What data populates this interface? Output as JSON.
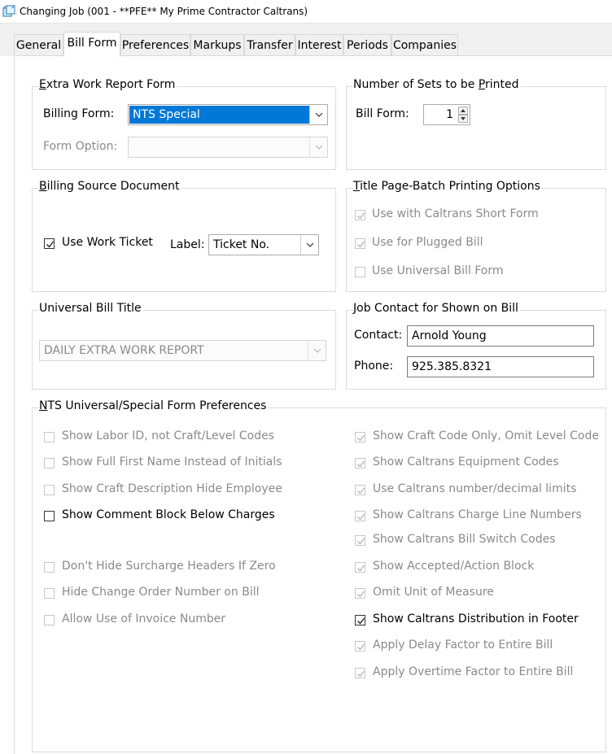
{
  "window": {
    "title": "Changing Job  (001 - **PFE** My Prime Contractor Caltrans)"
  },
  "tabs": [
    {
      "label": "General"
    },
    {
      "label": "Bill Form"
    },
    {
      "label": "Preferences"
    },
    {
      "label": "Markups"
    },
    {
      "label": "Transfer"
    },
    {
      "label": "Interest"
    },
    {
      "label": "Periods"
    },
    {
      "label": "Companies"
    }
  ],
  "extra_work_report_form": {
    "legend_underlined": "E",
    "legend_rest": "xtra Work Report Form",
    "billing_form_label": "Billing Form:",
    "billing_form_value": "NTS Special",
    "form_option_label": "Form Option:",
    "form_option_value": ""
  },
  "number_of_sets": {
    "legend": "Number of Sets to be ",
    "legend_underlined": "P",
    "legend_rest": "rinted",
    "bill_form_label": "Bill Form:",
    "bill_form_value": "1"
  },
  "billing_source_document": {
    "legend_underlined": "B",
    "legend_rest": "illing Source Document",
    "use_work_ticket_label": "Use Work Ticket",
    "use_work_ticket_checked": true,
    "label_label": "Label:",
    "label_value": "Ticket No."
  },
  "title_page_batch": {
    "legend_underlined": "T",
    "legend_rest": "itle Page-Batch Printing Options",
    "options": [
      {
        "label": "Use with Caltrans Short Form",
        "checked": true
      },
      {
        "label": "Use for Plugged Bill",
        "checked": true
      },
      {
        "label": "Use Universal Bill Form",
        "checked": false
      }
    ]
  },
  "universal_bill_title": {
    "legend": "Universal Bill Title",
    "value": "DAILY EXTRA WORK REPORT"
  },
  "job_contact": {
    "legend_underlined": "J",
    "legend_rest": "ob Contact for Shown on Bill",
    "contact_label": "Contact:",
    "contact_value": "Arnold Young",
    "phone_label": "Phone:",
    "phone_value": "925.385.8321"
  },
  "nts_preferences": {
    "legend_underlined": "N",
    "legend_rest": "TS Universal/Special Form Preferences",
    "left": [
      {
        "label": "Show Labor ID, not Craft/Level Codes",
        "checked": false,
        "enabled": false
      },
      {
        "label": "Show Full First Name Instead of Initials",
        "checked": false,
        "enabled": false
      },
      {
        "label": "Show Craft Description Hide Employee",
        "checked": false,
        "enabled": false
      },
      {
        "label": "Show Comment Block Below Charges",
        "checked": false,
        "enabled": true
      },
      {
        "label": "Don't Hide Surcharge Headers If Zero",
        "checked": false,
        "enabled": false
      },
      {
        "label": "Hide Change Order Number on Bill",
        "checked": false,
        "enabled": false
      },
      {
        "label": "Allow Use of Invoice Number",
        "checked": false,
        "enabled": false
      }
    ],
    "right": [
      {
        "label": "Show Craft Code Only, Omit Level Code",
        "checked": true,
        "enabled": false
      },
      {
        "label": "Show Caltrans Equipment Codes",
        "checked": true,
        "enabled": false
      },
      {
        "label": "Use Caltrans number/decimal limits",
        "checked": true,
        "enabled": false
      },
      {
        "label": "Show Caltrans Charge Line Numbers",
        "checked": true,
        "enabled": false
      },
      {
        "label": "Show Caltrans Bill Switch Codes",
        "checked": true,
        "enabled": false
      },
      {
        "label": "Show Accepted/Action Block",
        "checked": true,
        "enabled": false
      },
      {
        "label": "Omit Unit of Measure",
        "checked": true,
        "enabled": false
      },
      {
        "label": "Show Caltrans Distribution in Footer",
        "checked": true,
        "enabled": true
      },
      {
        "label": "Apply Delay Factor to Entire Bill",
        "checked": true,
        "enabled": false
      },
      {
        "label": "Apply Overtime Factor to Entire Bill",
        "checked": true,
        "enabled": false
      }
    ]
  },
  "colors": {
    "selection": "#0078d7",
    "disabled_text": "#8a8a8a",
    "tab_bg": "#f0f0f0"
  }
}
